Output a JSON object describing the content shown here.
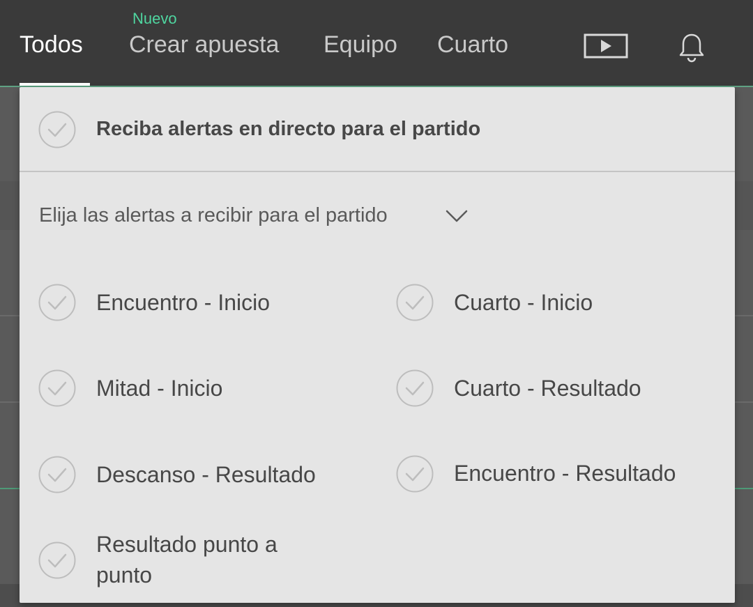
{
  "nav": {
    "tabs": [
      {
        "label": "Todos"
      },
      {
        "label": "Crear apuesta",
        "badge": "Nuevo"
      },
      {
        "label": "Equipo"
      },
      {
        "label": "Cuarto"
      }
    ],
    "icons": [
      "video-play-icon",
      "bell-icon"
    ],
    "active_tab": "Todos"
  },
  "panel": {
    "main_toggle_label": "Reciba alertas en directo para el partido",
    "section_header": "Elija las alertas a recibir para el partido",
    "options": [
      {
        "label": "Encuentro - Inicio"
      },
      {
        "label": "Cuarto - Inicio"
      },
      {
        "label": "Mitad - Inicio"
      },
      {
        "label": "Cuarto - Resultado"
      },
      {
        "label": "Descanso - Resultado"
      },
      {
        "label": "Encuentro - Resultado"
      },
      {
        "label": "Resultado punto a punto"
      }
    ]
  },
  "colors": {
    "topbar": "#3a3a3a",
    "accent_green": "#4fd6a0",
    "panel_bg": "#e5e5e5",
    "text_dark": "#474747",
    "check_gray": "#bdbdbd"
  }
}
